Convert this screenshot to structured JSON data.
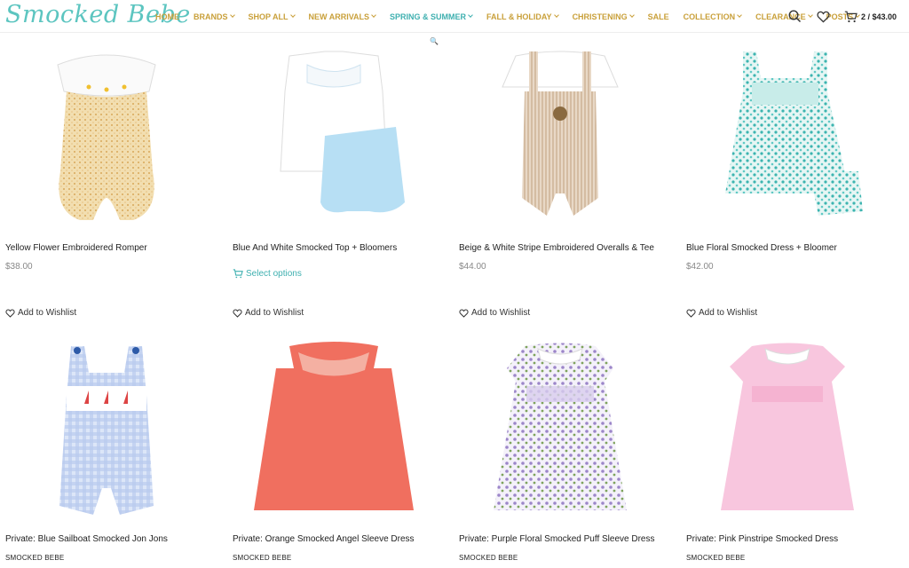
{
  "header": {
    "logo": "Smocked Bebe",
    "nav": [
      {
        "label": "HOME",
        "teal": false,
        "dropdown": false
      },
      {
        "label": "BRANDS",
        "teal": false,
        "dropdown": true
      },
      {
        "label": "SHOP ALL",
        "teal": false,
        "dropdown": true
      },
      {
        "label": "NEW ARRIVALS",
        "teal": false,
        "dropdown": true
      },
      {
        "label": "SPRING & SUMMER",
        "teal": true,
        "dropdown": true
      },
      {
        "label": "FALL & HOLIDAY",
        "teal": false,
        "dropdown": true
      },
      {
        "label": "CHRISTENING",
        "teal": false,
        "dropdown": true
      },
      {
        "label": "SALE",
        "teal": false,
        "dropdown": false
      },
      {
        "label": "COLLECTION",
        "teal": false,
        "dropdown": true
      },
      {
        "label": "CLEARANCE",
        "teal": false,
        "dropdown": true
      },
      {
        "label": "POSTS",
        "teal": false,
        "dropdown": true
      }
    ],
    "cart": "2 / $43.00",
    "icons": {
      "search": "search-icon",
      "wishlist": "heart-icon",
      "cart": "cart-icon"
    }
  },
  "colors": {
    "logo": "#5cc5c0",
    "nav": "#c9a03a",
    "accent": "#3fb0b0"
  },
  "products": [
    {
      "title": "Yellow Flower Embroidered Romper",
      "price": "$38.00",
      "wishlist": "Add to Wishlist"
    },
    {
      "title": "Blue And White Smocked Top + Bloomers",
      "select": "Select options",
      "wishlist": "Add to Wishlist"
    },
    {
      "title": "Beige & White Stripe Embroidered Overalls & Tee",
      "price": "$44.00",
      "wishlist": "Add to Wishlist"
    },
    {
      "title": "Blue Floral Smocked Dress + Bloomer",
      "price": "$42.00",
      "wishlist": "Add to Wishlist"
    },
    {
      "title": "Private: Blue Sailboat Smocked Jon Jons",
      "brand": "SMOCKED BEBE"
    },
    {
      "title": "Private: Orange Smocked Angel Sleeve Dress",
      "brand": "SMOCKED BEBE"
    },
    {
      "title": "Private: Purple Floral Smocked Puff Sleeve Dress",
      "brand": "SMOCKED BEBE"
    },
    {
      "title": "Private: Pink Pinstripe Smocked Dress",
      "brand": "SMOCKED BEBE"
    }
  ]
}
